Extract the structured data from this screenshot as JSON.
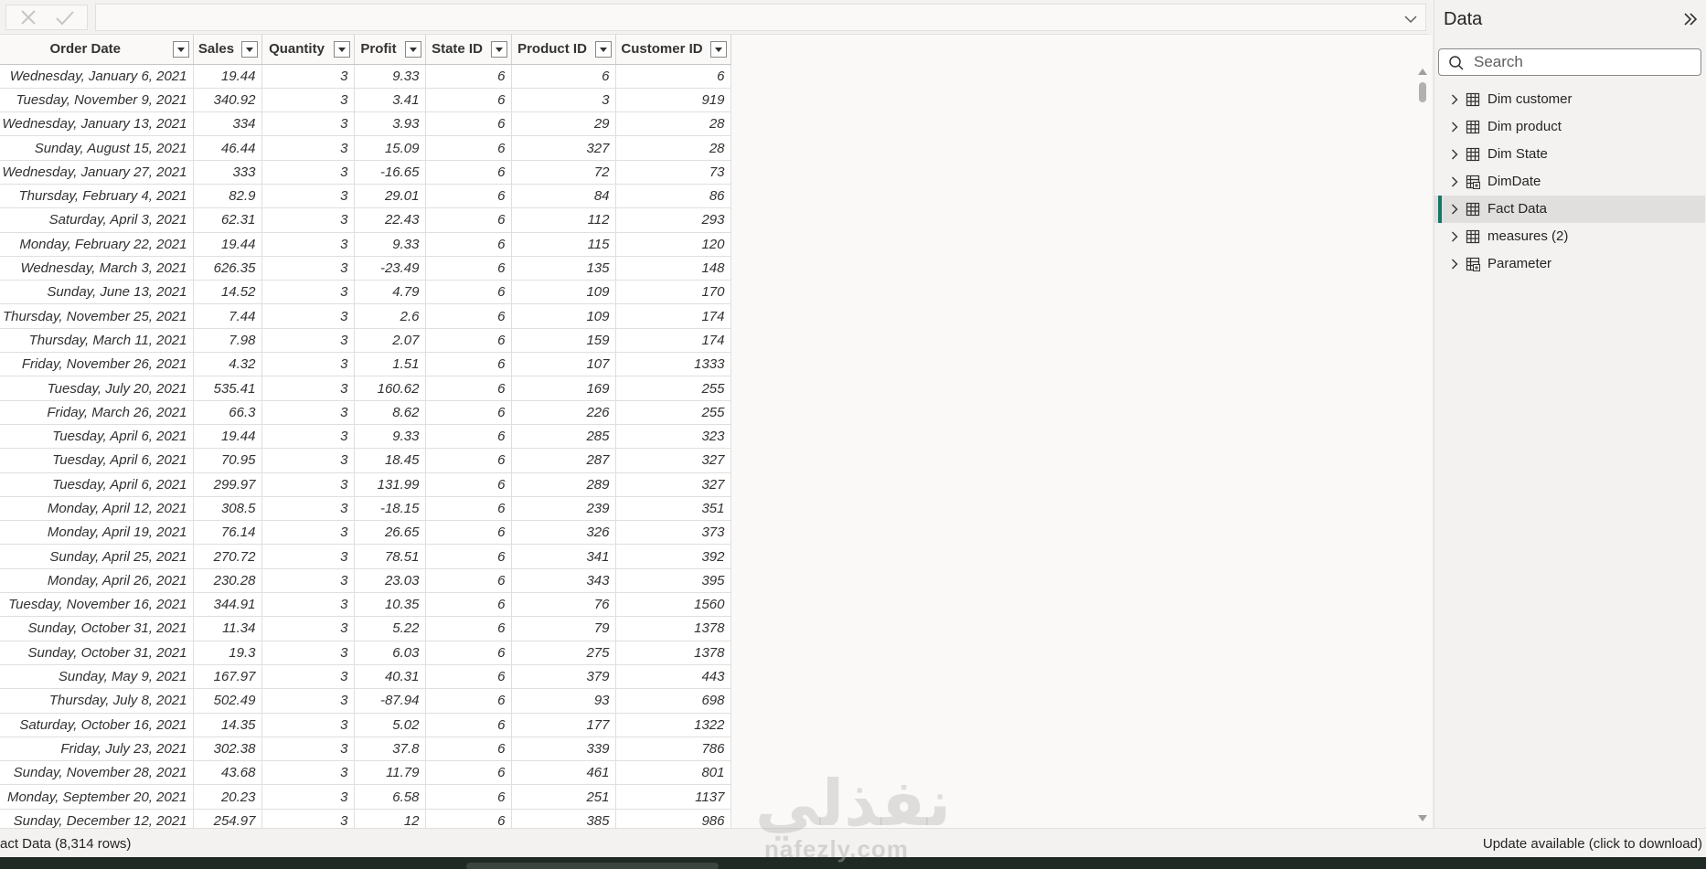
{
  "formula_bar": {
    "value": ""
  },
  "table": {
    "columns": [
      {
        "key": "order_date",
        "label": "Order Date"
      },
      {
        "key": "sales",
        "label": "Sales"
      },
      {
        "key": "quantity",
        "label": "Quantity"
      },
      {
        "key": "profit",
        "label": "Profit"
      },
      {
        "key": "state_id",
        "label": "State ID"
      },
      {
        "key": "product_id",
        "label": "Product ID"
      },
      {
        "key": "customer_id",
        "label": "Customer ID"
      }
    ],
    "rows": [
      [
        "Wednesday, January 6, 2021",
        "19.44",
        "3",
        "9.33",
        "6",
        "6",
        "6"
      ],
      [
        "Tuesday, November 9, 2021",
        "340.92",
        "3",
        "3.41",
        "6",
        "3",
        "919"
      ],
      [
        "Wednesday, January 13, 2021",
        "334",
        "3",
        "3.93",
        "6",
        "29",
        "28"
      ],
      [
        "Sunday, August 15, 2021",
        "46.44",
        "3",
        "15.09",
        "6",
        "327",
        "28"
      ],
      [
        "Wednesday, January 27, 2021",
        "333",
        "3",
        "-16.65",
        "6",
        "72",
        "73"
      ],
      [
        "Thursday, February 4, 2021",
        "82.9",
        "3",
        "29.01",
        "6",
        "84",
        "86"
      ],
      [
        "Saturday, April 3, 2021",
        "62.31",
        "3",
        "22.43",
        "6",
        "112",
        "293"
      ],
      [
        "Monday, February 22, 2021",
        "19.44",
        "3",
        "9.33",
        "6",
        "115",
        "120"
      ],
      [
        "Wednesday, March 3, 2021",
        "626.35",
        "3",
        "-23.49",
        "6",
        "135",
        "148"
      ],
      [
        "Sunday, June 13, 2021",
        "14.52",
        "3",
        "4.79",
        "6",
        "109",
        "170"
      ],
      [
        "Thursday, November 25, 2021",
        "7.44",
        "3",
        "2.6",
        "6",
        "109",
        "174"
      ],
      [
        "Thursday, March 11, 2021",
        "7.98",
        "3",
        "2.07",
        "6",
        "159",
        "174"
      ],
      [
        "Friday, November 26, 2021",
        "4.32",
        "3",
        "1.51",
        "6",
        "107",
        "1333"
      ],
      [
        "Tuesday, July 20, 2021",
        "535.41",
        "3",
        "160.62",
        "6",
        "169",
        "255"
      ],
      [
        "Friday, March 26, 2021",
        "66.3",
        "3",
        "8.62",
        "6",
        "226",
        "255"
      ],
      [
        "Tuesday, April 6, 2021",
        "19.44",
        "3",
        "9.33",
        "6",
        "285",
        "323"
      ],
      [
        "Tuesday, April 6, 2021",
        "70.95",
        "3",
        "18.45",
        "6",
        "287",
        "327"
      ],
      [
        "Tuesday, April 6, 2021",
        "299.97",
        "3",
        "131.99",
        "6",
        "289",
        "327"
      ],
      [
        "Monday, April 12, 2021",
        "308.5",
        "3",
        "-18.15",
        "6",
        "239",
        "351"
      ],
      [
        "Monday, April 19, 2021",
        "76.14",
        "3",
        "26.65",
        "6",
        "326",
        "373"
      ],
      [
        "Sunday, April 25, 2021",
        "270.72",
        "3",
        "78.51",
        "6",
        "341",
        "392"
      ],
      [
        "Monday, April 26, 2021",
        "230.28",
        "3",
        "23.03",
        "6",
        "343",
        "395"
      ],
      [
        "Tuesday, November 16, 2021",
        "344.91",
        "3",
        "10.35",
        "6",
        "76",
        "1560"
      ],
      [
        "Sunday, October 31, 2021",
        "11.34",
        "3",
        "5.22",
        "6",
        "79",
        "1378"
      ],
      [
        "Sunday, October 31, 2021",
        "19.3",
        "3",
        "6.03",
        "6",
        "275",
        "1378"
      ],
      [
        "Sunday, May 9, 2021",
        "167.97",
        "3",
        "40.31",
        "6",
        "379",
        "443"
      ],
      [
        "Thursday, July 8, 2021",
        "502.49",
        "3",
        "-87.94",
        "6",
        "93",
        "698"
      ],
      [
        "Saturday, October 16, 2021",
        "14.35",
        "3",
        "5.02",
        "6",
        "177",
        "1322"
      ],
      [
        "Friday, July 23, 2021",
        "302.38",
        "3",
        "37.8",
        "6",
        "339",
        "786"
      ],
      [
        "Sunday, November 28, 2021",
        "43.68",
        "3",
        "11.79",
        "6",
        "461",
        "801"
      ],
      [
        "Monday, September 20, 2021",
        "20.23",
        "3",
        "6.58",
        "6",
        "251",
        "1137"
      ],
      [
        "Sunday, December 12, 2021",
        "254.97",
        "3",
        "12",
        "6",
        "385",
        "986"
      ]
    ]
  },
  "data_pane": {
    "title": "Data",
    "search_placeholder": "Search",
    "items": [
      {
        "label": "Dim customer",
        "icon": "table-icon",
        "selected": false
      },
      {
        "label": "Dim product",
        "icon": "table-icon",
        "selected": false
      },
      {
        "label": "Dim State",
        "icon": "table-icon",
        "selected": false
      },
      {
        "label": "DimDate",
        "icon": "calculated-table-icon",
        "selected": false
      },
      {
        "label": "Fact Data",
        "icon": "table-icon",
        "selected": true
      },
      {
        "label": "measures (2)",
        "icon": "table-icon",
        "selected": false
      },
      {
        "label": "Parameter",
        "icon": "calculated-table-icon",
        "selected": false
      }
    ]
  },
  "status": {
    "left": "act Data (8,314 rows)",
    "right": "Update available (click to download)"
  },
  "watermark": {
    "arabic": "نفذلي",
    "latin": "nafezly.com"
  },
  "colors": {
    "accent": "#117865",
    "background": "#f3f2f1",
    "grid_line": "#e1dfdd"
  }
}
